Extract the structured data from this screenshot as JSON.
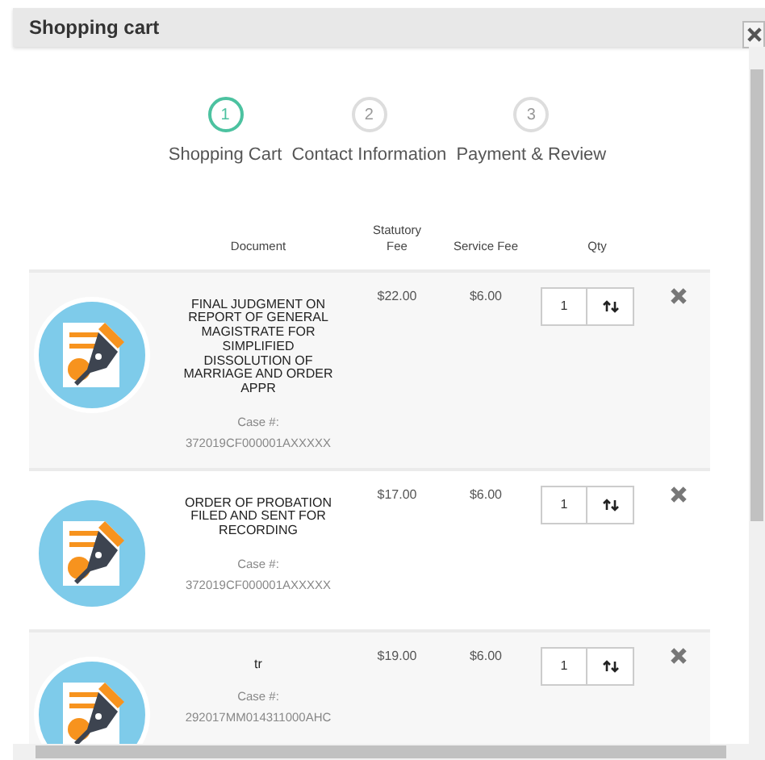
{
  "dialog": {
    "title": "Shopping cart"
  },
  "steps": [
    {
      "number": "1",
      "label": "Shopping Cart",
      "selected": true
    },
    {
      "number": "2",
      "label": "Contact Information",
      "selected": false
    },
    {
      "number": "3",
      "label": "Payment & Review",
      "selected": false
    }
  ],
  "table": {
    "columns": [
      "Document",
      "Statutory Fee",
      "Service Fee",
      "Qty"
    ],
    "rows": [
      {
        "document": "FINAL JUDGMENT ON REPORT OF GENERAL MAGISTRATE FOR SIMPLIFIED DISSOLUTION OF MARRIAGE AND ORDER APPR",
        "case_label": "Case #:",
        "case_number": "372019CF000001AXXXXX",
        "statutory_fee": "$22.00",
        "service_fee": "$6.00",
        "qty": "1"
      },
      {
        "document": "ORDER OF PROBATION FILED AND SENT FOR RECORDING",
        "case_label": "Case #:",
        "case_number": "372019CF000001AXXXXX",
        "statutory_fee": "$17.00",
        "service_fee": "$6.00",
        "qty": "1"
      },
      {
        "document": "tr",
        "case_label": "Case #:",
        "case_number": "292017MM014311000AHC",
        "statutory_fee": "$19.00",
        "service_fee": "$6.00",
        "qty": "1"
      }
    ]
  }
}
